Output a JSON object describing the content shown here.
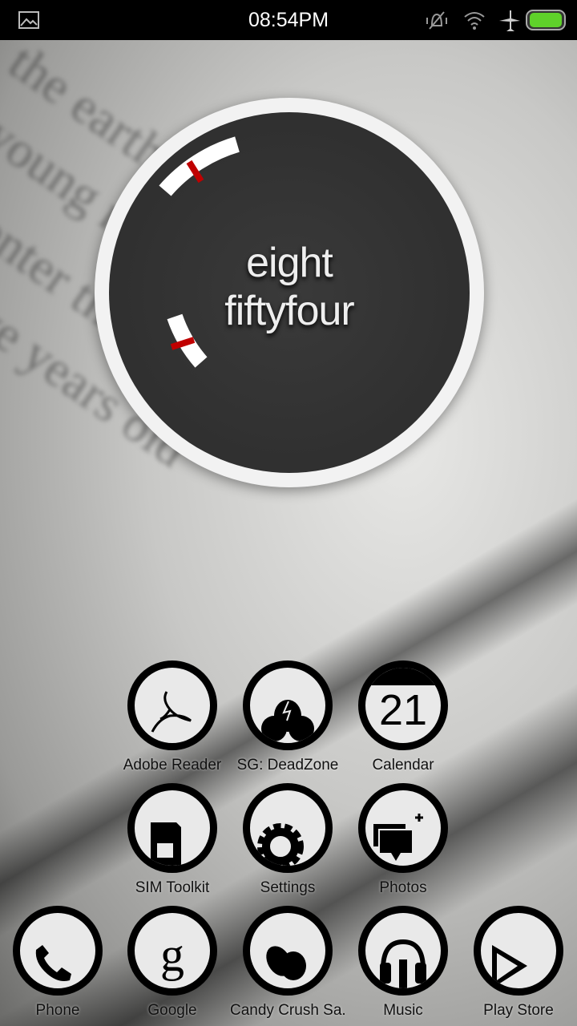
{
  "status_bar": {
    "time": "08:54PM",
    "icons": [
      "gallery-notification-icon",
      "vibrate-off-icon",
      "wifi-icon",
      "airplane-icon",
      "battery-icon"
    ],
    "battery_color": "#5fd12a"
  },
  "clock_widget": {
    "hour_text": "eight",
    "minute_text": "fiftyfour",
    "accent": "#c00000"
  },
  "apps": [
    {
      "label": "Adobe Reader",
      "icon": "adobe-reader-icon"
    },
    {
      "label": "SG: DeadZone",
      "icon": "deadzone-icon"
    },
    {
      "label": "Calendar",
      "icon": "calendar-icon",
      "day": "21"
    },
    {
      "label": "SIM Toolkit",
      "icon": "sim-card-icon"
    },
    {
      "label": "Settings",
      "icon": "gear-icon"
    },
    {
      "label": "Photos",
      "icon": "photos-icon"
    }
  ],
  "dock": [
    {
      "label": "Phone",
      "icon": "phone-icon"
    },
    {
      "label": "Google",
      "icon": "google-icon"
    },
    {
      "label": "Candy Crush Sa...",
      "icon": "candy-crush-icon"
    },
    {
      "label": "Music",
      "icon": "headphones-icon"
    },
    {
      "label": "Play Store",
      "icon": "play-store-icon"
    }
  ]
}
